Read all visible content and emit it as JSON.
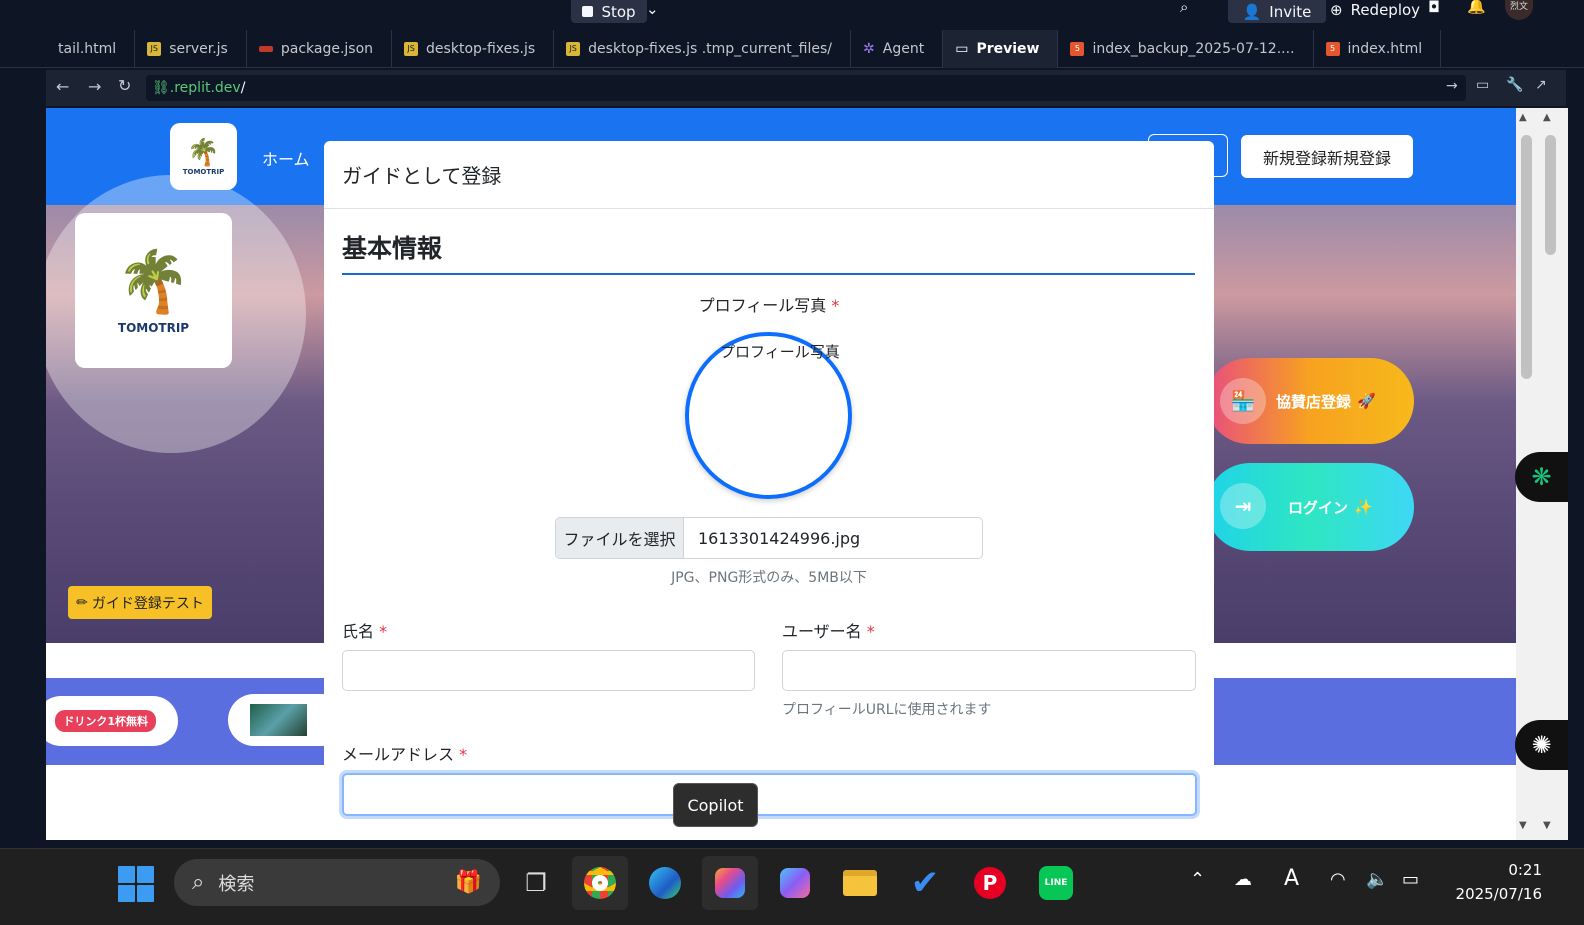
{
  "topbar": {
    "stop_label": "Stop",
    "invite_label": "Invite",
    "redeploy_label": "Redeploy",
    "user_badge": "烈文"
  },
  "tabs": [
    {
      "label": "tail.html",
      "icon": "html-file-icon"
    },
    {
      "label": "server.js",
      "icon": "js-file-icon"
    },
    {
      "label": "package.json",
      "icon": "json-file-icon"
    },
    {
      "label": "desktop-fixes.js",
      "icon": "js-file-icon"
    },
    {
      "label": "desktop-fixes.js .tmp_current_files/",
      "icon": "js-file-icon"
    },
    {
      "label": "Agent",
      "icon": "agent-icon"
    },
    {
      "label": "Preview",
      "icon": "monitor-icon",
      "active": true
    },
    {
      "label": "index_backup_2025-07-12....",
      "icon": "html-file-icon"
    },
    {
      "label": "index.html",
      "icon": "html-file-icon"
    }
  ],
  "url": {
    "host": ".replit.dev",
    "path": "/"
  },
  "site": {
    "brand": "TOMOTRIP",
    "nav_home": "ホーム",
    "signup_label": "新規登録新規登録",
    "guide_test_label": "ガイド登録テスト",
    "sponsor_label": "協賛店登録",
    "login_label": "ログイン",
    "drink_badge": "ドリンク1杯無料"
  },
  "modal": {
    "title": "ガイドとして登録",
    "section_title": "基本情報",
    "photo_label": "プロフィール写真",
    "photo_alt": "プロフィール写真",
    "file_button": "ファイルを選択",
    "file_name": "1613301424996.jpg",
    "file_hint": "JPG、PNG形式のみ、5MB以下",
    "name_label": "氏名",
    "username_label": "ユーザー名",
    "username_help": "プロフィールURLに使用されます",
    "email_label": "メールアドレス",
    "required_mark": "*",
    "name_value": "",
    "username_value": "",
    "email_value": ""
  },
  "tooltip": {
    "text": "Copilot"
  },
  "taskbar": {
    "search_placeholder": "検索",
    "time": "0:21",
    "date": "2025/07/16"
  },
  "colors": {
    "primary": "#0d6efd",
    "nav_blue": "#1a73f0",
    "required": "#dc3545",
    "ide_bg": "#0e1525"
  }
}
